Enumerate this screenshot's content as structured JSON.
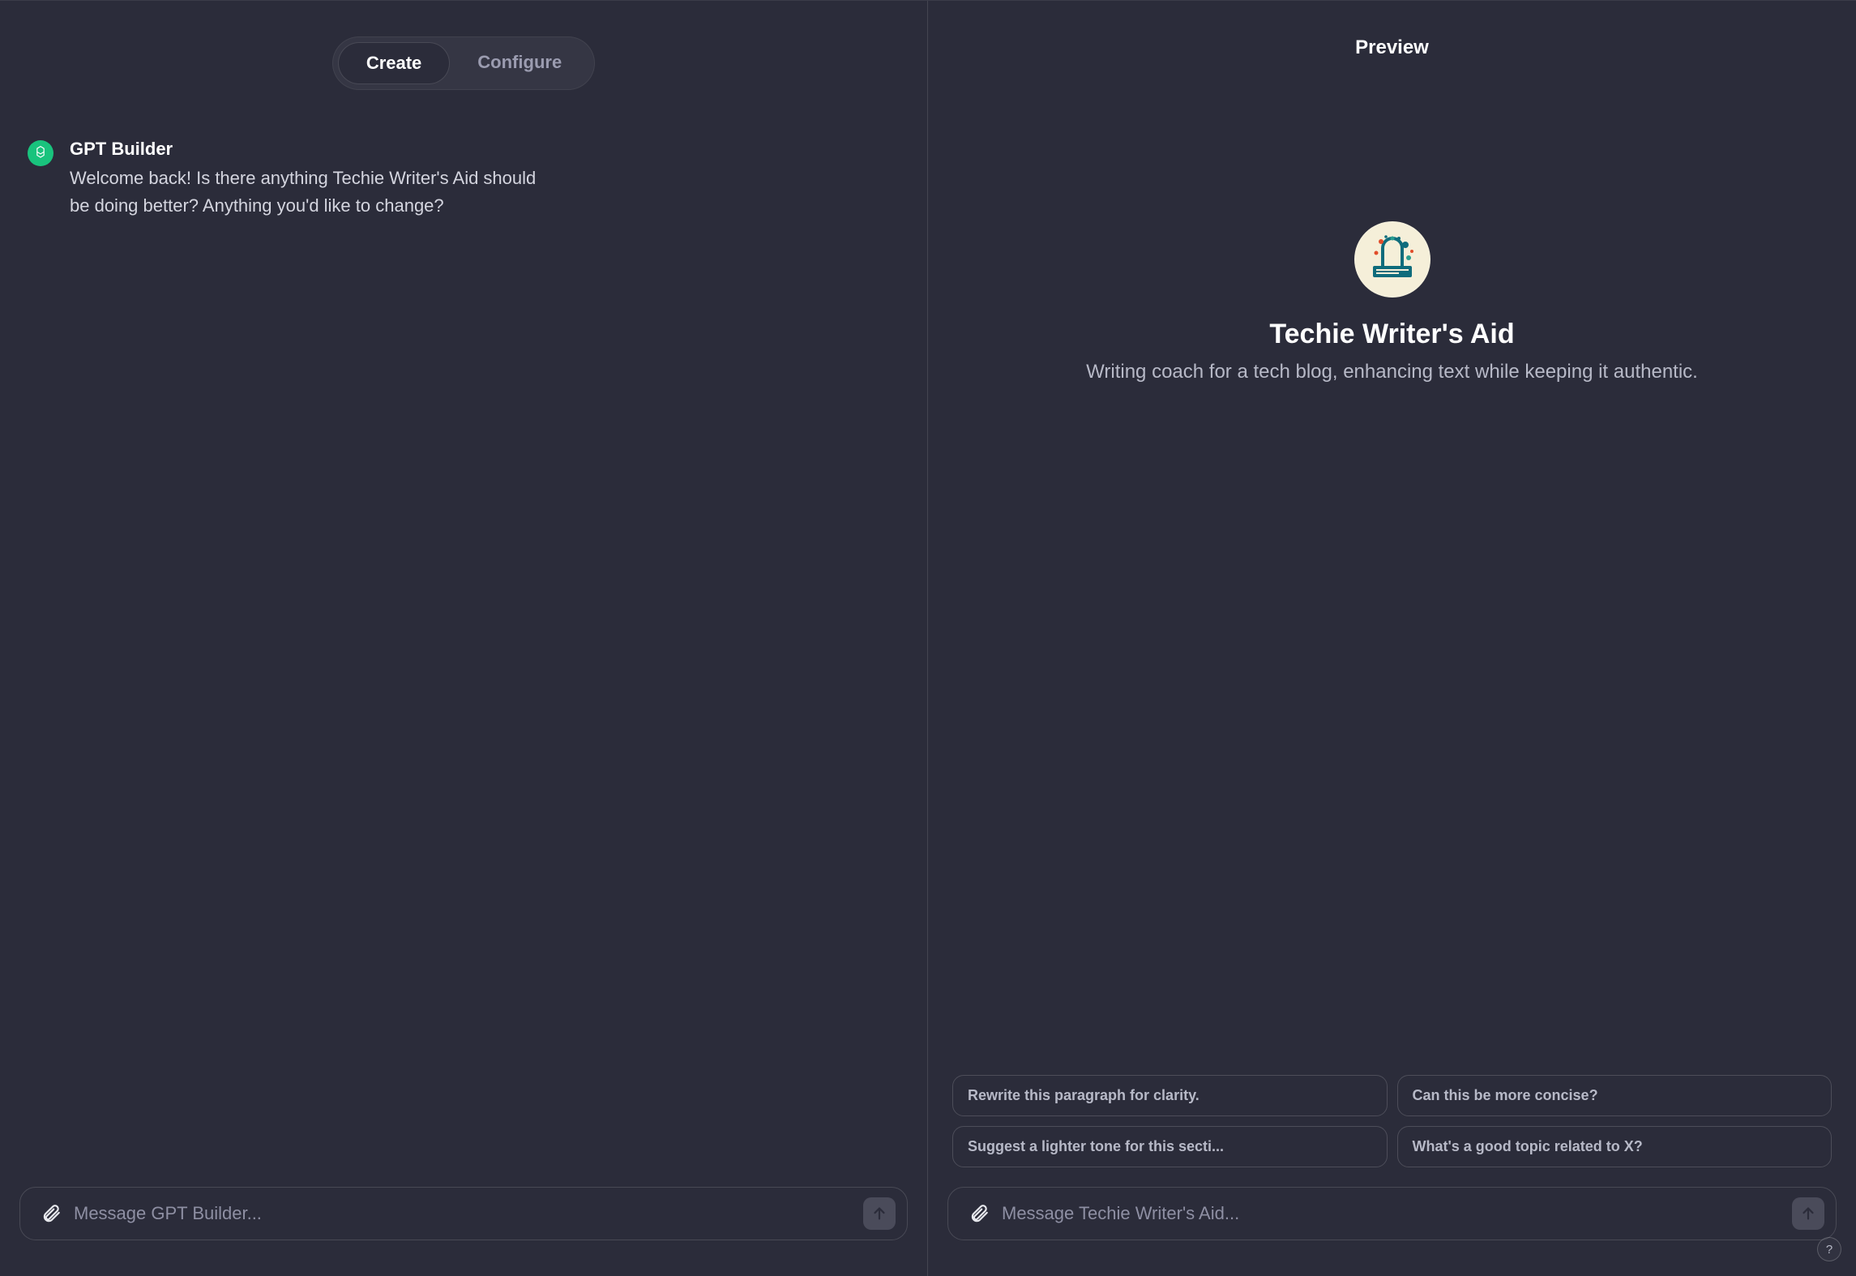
{
  "tabs": {
    "create": "Create",
    "configure": "Configure",
    "active": "create"
  },
  "builder": {
    "name": "GPT Builder",
    "greeting": "Welcome back! Is there anything Techie Writer's Aid should be doing better? Anything you'd like to change?",
    "input_placeholder": "Message GPT Builder..."
  },
  "preview": {
    "header": "Preview",
    "title": "Techie Writer's Aid",
    "description": "Writing coach for a tech blog, enhancing text while keeping it authentic.",
    "suggestions": [
      "Rewrite this paragraph for clarity.",
      "Can this be more concise?",
      "Suggest a lighter tone for this secti...",
      "What's a good topic related to X?"
    ],
    "input_placeholder": "Message Techie Writer's Aid..."
  },
  "help_label": "?"
}
